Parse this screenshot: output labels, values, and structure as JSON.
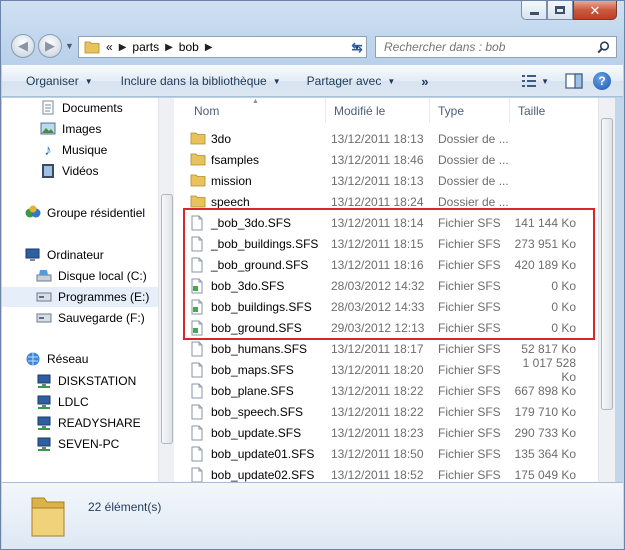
{
  "window": {
    "minimize_icon": "minimize-icon",
    "maximize_icon": "maximize-icon",
    "close_icon": "close-icon"
  },
  "address": {
    "overflow": "«",
    "crumbs": [
      "parts",
      "bob"
    ]
  },
  "search": {
    "placeholder": "Rechercher dans : bob"
  },
  "toolbar": {
    "organize": "Organiser",
    "include": "Inclure dans la bibliothèque",
    "share": "Partager avec",
    "more": "»"
  },
  "nav": {
    "items": [
      {
        "label": "Documents",
        "icon": "documents-icon"
      },
      {
        "label": "Images",
        "icon": "images-icon"
      },
      {
        "label": "Musique",
        "icon": "music-icon"
      },
      {
        "label": "Vidéos",
        "icon": "videos-icon"
      },
      {
        "label": "Groupe résidentiel",
        "icon": "homegroup-icon"
      },
      {
        "label": "Ordinateur",
        "icon": "computer-icon"
      },
      {
        "label": "Disque local (C:)",
        "icon": "drive-icon"
      },
      {
        "label": "Programmes (E:)",
        "icon": "drive-icon"
      },
      {
        "label": "Sauvegarde (F:)",
        "icon": "drive-icon"
      },
      {
        "label": "Réseau",
        "icon": "network-icon"
      },
      {
        "label": "DISKSTATION",
        "icon": "network-computer-icon"
      },
      {
        "label": "LDLC",
        "icon": "network-computer-icon"
      },
      {
        "label": "READYSHARE",
        "icon": "network-computer-icon"
      },
      {
        "label": "SEVEN-PC",
        "icon": "network-computer-icon"
      }
    ]
  },
  "columns": {
    "name": "Nom",
    "date": "Modifié le",
    "type": "Type",
    "size": "Taille"
  },
  "files": [
    {
      "name": "3do",
      "date": "13/12/2011 18:13",
      "type": "Dossier de ...",
      "size": "",
      "kind": "folder"
    },
    {
      "name": "fsamples",
      "date": "13/12/2011 18:46",
      "type": "Dossier de ...",
      "size": "",
      "kind": "folder"
    },
    {
      "name": "mission",
      "date": "13/12/2011 18:13",
      "type": "Dossier de ...",
      "size": "",
      "kind": "folder"
    },
    {
      "name": "speech",
      "date": "13/12/2011 18:24",
      "type": "Dossier de ...",
      "size": "",
      "kind": "folder"
    },
    {
      "name": "_bob_3do.SFS",
      "date": "13/12/2011 18:14",
      "type": "Fichier SFS",
      "size": "141 144 Ko",
      "kind": "file"
    },
    {
      "name": "_bob_buildings.SFS",
      "date": "13/12/2011 18:15",
      "type": "Fichier SFS",
      "size": "273 951 Ko",
      "kind": "file"
    },
    {
      "name": "_bob_ground.SFS",
      "date": "13/12/2011 18:16",
      "type": "Fichier SFS",
      "size": "420 189 Ko",
      "kind": "file"
    },
    {
      "name": "bob_3do.SFS",
      "date": "28/03/2012 14:32",
      "type": "Fichier SFS",
      "size": "0 Ko",
      "kind": "green"
    },
    {
      "name": "bob_buildings.SFS",
      "date": "28/03/2012 14:33",
      "type": "Fichier SFS",
      "size": "0 Ko",
      "kind": "green"
    },
    {
      "name": "bob_ground.SFS",
      "date": "29/03/2012 12:13",
      "type": "Fichier SFS",
      "size": "0 Ko",
      "kind": "green"
    },
    {
      "name": "bob_humans.SFS",
      "date": "13/12/2011 18:17",
      "type": "Fichier SFS",
      "size": "52 817 Ko",
      "kind": "file"
    },
    {
      "name": "bob_maps.SFS",
      "date": "13/12/2011 18:20",
      "type": "Fichier SFS",
      "size": "1 017 528 Ko",
      "kind": "file"
    },
    {
      "name": "bob_plane.SFS",
      "date": "13/12/2011 18:22",
      "type": "Fichier SFS",
      "size": "667 898 Ko",
      "kind": "file"
    },
    {
      "name": "bob_speech.SFS",
      "date": "13/12/2011 18:22",
      "type": "Fichier SFS",
      "size": "179 710 Ko",
      "kind": "file"
    },
    {
      "name": "bob_update.SFS",
      "date": "13/12/2011 18:23",
      "type": "Fichier SFS",
      "size": "290 733 Ko",
      "kind": "file"
    },
    {
      "name": "bob_update01.SFS",
      "date": "13/12/2011 18:50",
      "type": "Fichier SFS",
      "size": "135 364 Ko",
      "kind": "file"
    },
    {
      "name": "bob_update02.SFS",
      "date": "13/12/2011 18:52",
      "type": "Fichier SFS",
      "size": "175 049 Ko",
      "kind": "file"
    }
  ],
  "status": {
    "count": "22 élément(s)"
  },
  "colors": {
    "highlight": "#d7262e",
    "folder": "#e8c25a",
    "selection": "#e5eef9"
  }
}
